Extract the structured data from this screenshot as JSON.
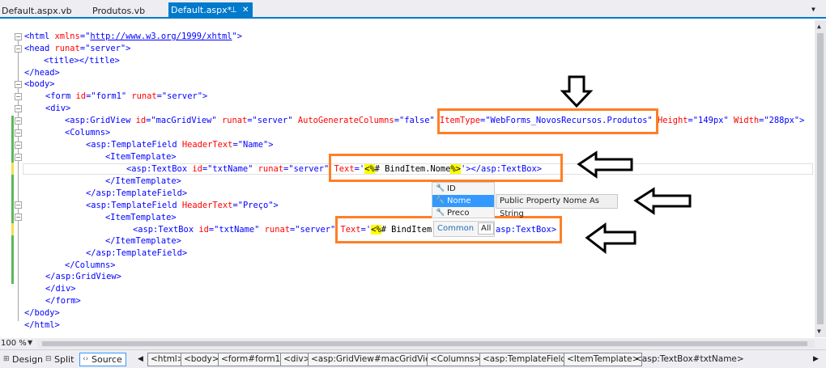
{
  "tabs": [
    {
      "label": "Default.aspx.vb",
      "active": false
    },
    {
      "label": "Produtos.vb",
      "active": false
    },
    {
      "label": "Default.aspx*",
      "active": true,
      "pin": "⊥",
      "close": "✕"
    }
  ],
  "editor": {
    "html_open": "<html",
    "xmlns_attr": " xmlns",
    "xmlns_eq": "=\"",
    "xmlns_url": "http://www.w3.org/1999/xhtml",
    "xmlns_end": "\">",
    "head_open": "<head",
    "runat": " runat",
    "server_val": "=\"server\"",
    "gt": ">",
    "title_line": "<title></title>",
    "head_close": "</head>",
    "body_open": "<body>",
    "form_open": "<form",
    "id_attr": " id",
    "form_id_val": "=\"form1\"",
    "div_open": "<div>",
    "gridview_tag": "<asp:GridView",
    "gridview_id_val": "=\"macGridView\"",
    "autogen_attr": " AutoGenerateColumns",
    "autogen_val": "=\"false\"",
    "itemtype_attr": "ItemType",
    "itemtype_val": "=\"WebForms_NovosRecursos.Produtos\"",
    "height_attr": " Height",
    "height_val": "=\"149px\"",
    "width_attr": " Width",
    "width_val": "=\"288px\">",
    "columns_open": "<Columns>",
    "templatefield_tag": "<asp:TemplateField",
    "headertext_attr": " HeaderText",
    "headertext_name_val": "=\"Name\"",
    "itemtemplate_open": "<ItemTemplate>",
    "textbox_tag": "<asp:TextBox",
    "txtname_val": "=\"txtName\"",
    "text_attr": "Text",
    "text_q": "='",
    "expr_open": "<%",
    "expr_hash": "# BindItem.Nome",
    "expr_close": "%>",
    "text_end": "'>",
    "textbox_close": "</asp:TextBox>",
    "itemtemplate_close": "</ItemTemplate>",
    "templatefield_close": "</asp:TemplateField>",
    "headertext_preco_val": "=\"Preço\"",
    "expr_hash2": "# BindItem",
    "textbox_close2": "asp:TextBox>",
    "columns_close": "</Columns>",
    "gridview_close": "</asp:GridView>",
    "div_close": "</div>",
    "form_close": "</form>",
    "body_close": "</body>",
    "html_close": "</html>"
  },
  "intellisense": {
    "items": [
      "ID",
      "Nome",
      "Preco"
    ],
    "selected": "Nome",
    "tooltip": "Public Property Nome As String",
    "filter_common": "Common",
    "filter_all": "All"
  },
  "status": {
    "zoom": "100 %",
    "views": [
      "Design",
      "Split",
      "Source"
    ],
    "active_view": "Source",
    "breadcrumbs": [
      "<html>",
      "<body>",
      "<form#form1>",
      "<div>",
      "<asp:GridView#macGridView>",
      "<Columns>",
      "<asp:TemplateField>",
      "<ItemTemplate>",
      "<asp:TextBox#txtName>"
    ]
  },
  "colors": {
    "callout": "#ff7f27",
    "accent": "#007acc",
    "selection": "#3399ff",
    "change_saved": "#5cb85c",
    "change_unsaved": "#f0e050"
  }
}
